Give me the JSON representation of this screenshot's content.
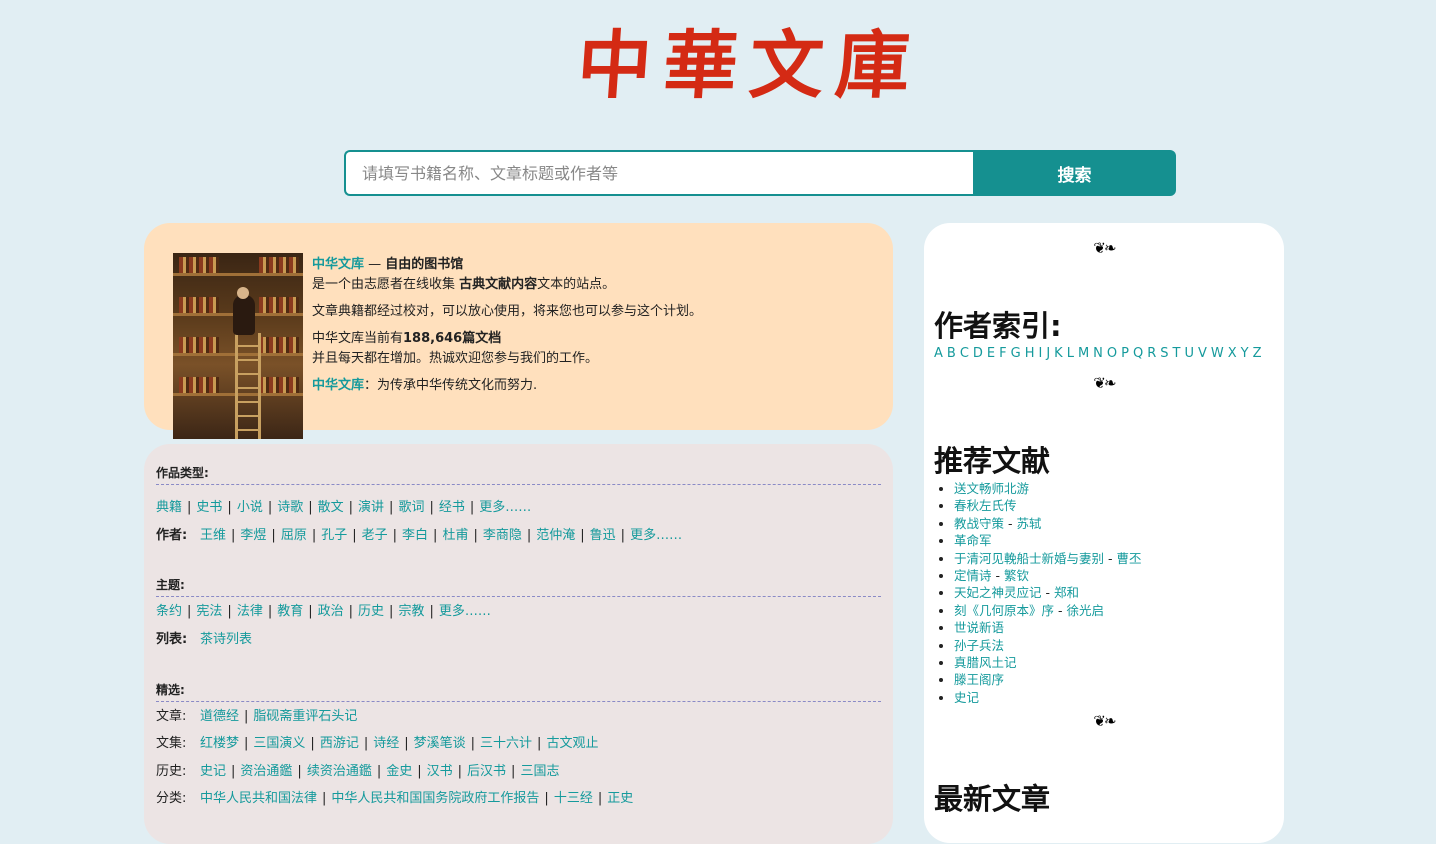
{
  "logo_text": "中華文庫",
  "search": {
    "placeholder": "请填写书籍名称、文章标题或作者等",
    "button_label": "搜索"
  },
  "intro": {
    "site_name": "中华文库",
    "dash": " — ",
    "tagline": "自由的图书馆",
    "line1_a": "是一个由志愿者在线收集 ",
    "line1_b": "古典文献内容",
    "line1_c": "文本的站点。",
    "line2": "文章典籍都经过校对，可以放心使用，将来您也可以参与这个计划。",
    "line3_a": "中华文库当前有",
    "line3_b": "188,646篇文档",
    "line4": "并且每天都在增加。热诚欢迎您参与我们的工作。",
    "line5_name": "中华文库",
    "line5_rest": "：为传承中华传统文化而努力."
  },
  "nav": {
    "types_heading": "作品类型:",
    "types": [
      "典籍",
      "史书",
      "小说",
      "诗歌",
      "散文",
      "演讲",
      "歌词",
      "经书",
      "更多……"
    ],
    "authors_label": "作者:",
    "authors": [
      "王维",
      "李煜",
      "屈原",
      "孔子",
      "老子",
      "李白",
      "杜甫",
      "李商隐",
      "范仲淹",
      "鲁迅",
      "更多……"
    ],
    "topics_heading": "主题:",
    "topics": [
      "条约",
      "宪法",
      "法律",
      "教育",
      "政治",
      "历史",
      "宗教",
      "更多……"
    ],
    "lists_label": "列表:",
    "lists": [
      "茶诗列表"
    ],
    "featured_heading": "精选:",
    "articles_label": "文章:",
    "articles": [
      "道德经",
      "脂砚斋重评石头记"
    ],
    "collections_label": "文集:",
    "collections": [
      "红楼梦",
      "三国演义",
      "西游记",
      "诗经",
      "梦溪笔谈",
      "三十六计",
      "古文观止"
    ],
    "history_label": "历史:",
    "history": [
      "史记",
      "资治通鑑",
      "续资治通鑑",
      "金史",
      "汉书",
      "后汉书",
      "三国志"
    ],
    "categories_label": "分类:",
    "categories": [
      "中华人民共和国法律",
      "中华人民共和国国务院政府工作报告",
      "十三经",
      "正史"
    ]
  },
  "side": {
    "ornament": "❦❧",
    "author_index_title": "作者索引:",
    "letters": [
      "A",
      "B",
      "C",
      "D",
      "E",
      "F",
      "G",
      "H",
      "I",
      "J",
      "K",
      "L",
      "M",
      "N",
      "O",
      "P",
      "Q",
      "R",
      "S",
      "T",
      "U",
      "V",
      "W",
      "X",
      "Y",
      "Z"
    ],
    "recommended_title": "推荐文献",
    "recommended": [
      {
        "title": "送文畅师北游",
        "author": ""
      },
      {
        "title": "春秋左氏传",
        "author": ""
      },
      {
        "title": "教战守策",
        "author": "苏轼"
      },
      {
        "title": "革命军",
        "author": ""
      },
      {
        "title": "于清河见輓船士新婚与妻别",
        "author": "曹丕"
      },
      {
        "title": "定情诗",
        "author": "繁钦"
      },
      {
        "title": "天妃之神灵应记",
        "author": "郑和"
      },
      {
        "title": "刻《几何原本》序",
        "author": "徐光启"
      },
      {
        "title": "世说新语",
        "author": ""
      },
      {
        "title": "孙子兵法",
        "author": ""
      },
      {
        "title": "真腊风土记",
        "author": ""
      },
      {
        "title": "滕王阁序",
        "author": ""
      },
      {
        "title": "史记",
        "author": ""
      }
    ],
    "latest_title": "最新文章"
  }
}
